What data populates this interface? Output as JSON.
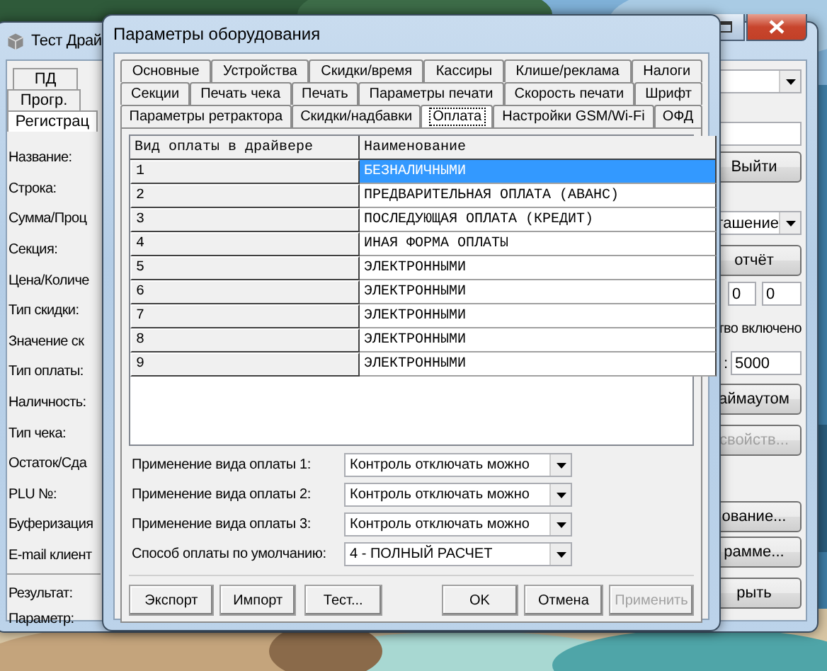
{
  "back_window": {
    "title": "Тест Драй",
    "tabs": [
      {
        "label": "ПД",
        "selected": false
      },
      {
        "label": "Прогр.",
        "selected": false
      },
      {
        "label": "Регистрац",
        "selected": true
      }
    ],
    "field_labels": [
      "Название:",
      "Строка:",
      "Сумма/Проц",
      "Секция:",
      "Цена/Количе",
      "Тип скидки:",
      "Значение ск",
      "Тип оплаты:",
      "Наличность:",
      "Тип чека:",
      "Остаток/Сда",
      "PLU №:",
      "Буферизация",
      "E-mail клиент"
    ],
    "result_labels": [
      "Результат:",
      "Параметр:"
    ],
    "right_controls": [
      {
        "kind": "dropdown"
      },
      {
        "kind": "field"
      },
      {
        "kind": "button",
        "label": "Выйти",
        "disabled": false
      },
      {
        "kind": "dropdown",
        "value": "гашение"
      },
      {
        "kind": "button",
        "label": "отчёт",
        "disabled": false
      },
      {
        "kind": "field_pair",
        "values": [
          "0",
          "0"
        ]
      },
      {
        "kind": "text",
        "label": "тво включено"
      },
      {
        "kind": "field",
        "label": ":",
        "value": "5000"
      },
      {
        "kind": "button",
        "label": "аймаутом",
        "disabled": false
      },
      {
        "kind": "button",
        "label": "свойств...",
        "disabled": true
      },
      {
        "kind": "button",
        "label": "ование...",
        "disabled": false
      },
      {
        "kind": "button",
        "label": "рамме...",
        "disabled": false
      },
      {
        "kind": "button",
        "label": "рыть",
        "disabled": false
      }
    ]
  },
  "dialog": {
    "title": "Параметры оборудования",
    "tab_rows": [
      [
        {
          "label": "Основные",
          "selected": false
        },
        {
          "label": "Устройства",
          "selected": false
        },
        {
          "label": "Скидки/время",
          "selected": false
        },
        {
          "label": "Кассиры",
          "selected": false
        },
        {
          "label": "Клише/реклама",
          "selected": false
        },
        {
          "label": "Налоги",
          "selected": false
        }
      ],
      [
        {
          "label": "Секции",
          "selected": false
        },
        {
          "label": "Печать чека",
          "selected": false
        },
        {
          "label": "Печать",
          "selected": false
        },
        {
          "label": "Параметры печати",
          "selected": false
        },
        {
          "label": "Скорость печати",
          "selected": false
        },
        {
          "label": "Шрифт",
          "selected": false
        }
      ],
      [
        {
          "label": "Параметры ретрактора",
          "selected": false
        },
        {
          "label": "Скидки/надбавки",
          "selected": false
        },
        {
          "label": "Оплата",
          "selected": true
        },
        {
          "label": "Настройки GSM/Wi-Fi",
          "selected": false
        },
        {
          "label": "ОФД",
          "selected": false
        }
      ]
    ],
    "table": {
      "columns": [
        "Вид оплаты в драйвере",
        "Наименование"
      ],
      "rows": [
        {
          "number": "1",
          "name": "БЕЗНАЛИЧНЫМИ",
          "selected": true
        },
        {
          "number": "2",
          "name": "ПРЕДВАРИТЕЛЬНАЯ ОПЛАТА (АВАНС)",
          "selected": false
        },
        {
          "number": "3",
          "name": "ПОСЛЕДУЮЩАЯ ОПЛАТА (КРЕДИТ)",
          "selected": false
        },
        {
          "number": "4",
          "name": "ИНАЯ ФОРМА ОПЛАТЫ",
          "selected": false
        },
        {
          "number": "5",
          "name": "ЭЛЕКТРОННЫМИ",
          "selected": false
        },
        {
          "number": "6",
          "name": "ЭЛЕКТРОННЫМИ",
          "selected": false
        },
        {
          "number": "7",
          "name": "ЭЛЕКТРОННЫМИ",
          "selected": false
        },
        {
          "number": "8",
          "name": "ЭЛЕКТРОННЫМИ",
          "selected": false
        },
        {
          "number": "9",
          "name": "ЭЛЕКТРОННЫМИ",
          "selected": false
        }
      ]
    },
    "settings": [
      {
        "label": "Применение вида оплаты 1:",
        "value": "Контроль отключать можно"
      },
      {
        "label": "Применение вида оплаты 2:",
        "value": "Контроль отключать можно"
      },
      {
        "label": "Применение вида оплаты 3:",
        "value": "Контроль отключать можно"
      },
      {
        "label": "Способ оплаты по умолчанию:",
        "value": "4 - ПОЛНЫЙ РАСЧЕТ"
      }
    ],
    "left_buttons": [
      {
        "label": "Экспорт",
        "disabled": false
      },
      {
        "label": "Импорт",
        "disabled": false
      },
      {
        "label": "Тест...",
        "disabled": false
      }
    ],
    "right_buttons": [
      {
        "label": "OK",
        "disabled": false
      },
      {
        "label": "Отмена",
        "disabled": false
      },
      {
        "label": "Применить",
        "disabled": true
      }
    ]
  }
}
